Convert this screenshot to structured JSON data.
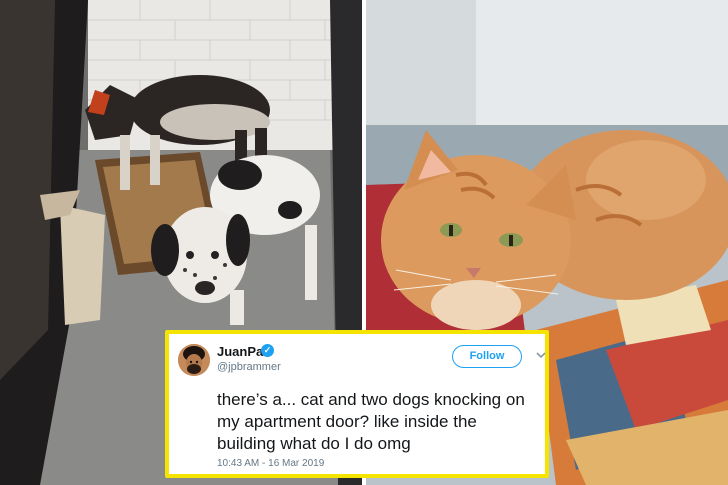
{
  "tweet": {
    "display_name": "JuanPa",
    "handle": "@jpbrammer",
    "follow_label": "Follow",
    "text": "there’s a... cat and two dogs knocking on my apartment door? like inside the building what do I do omg",
    "timestamp": "10:43 AM - 16 Mar 2019",
    "icons": {
      "verified": "verified-badge-icon",
      "menu": "chevron-down-icon"
    },
    "colors": {
      "accent": "#1da1f2",
      "border": "#f5e400"
    }
  },
  "photos": [
    {
      "subject": "two dogs on a doormat by an apartment door"
    },
    {
      "subject": "orange tabby cat lying on a blanket"
    }
  ]
}
